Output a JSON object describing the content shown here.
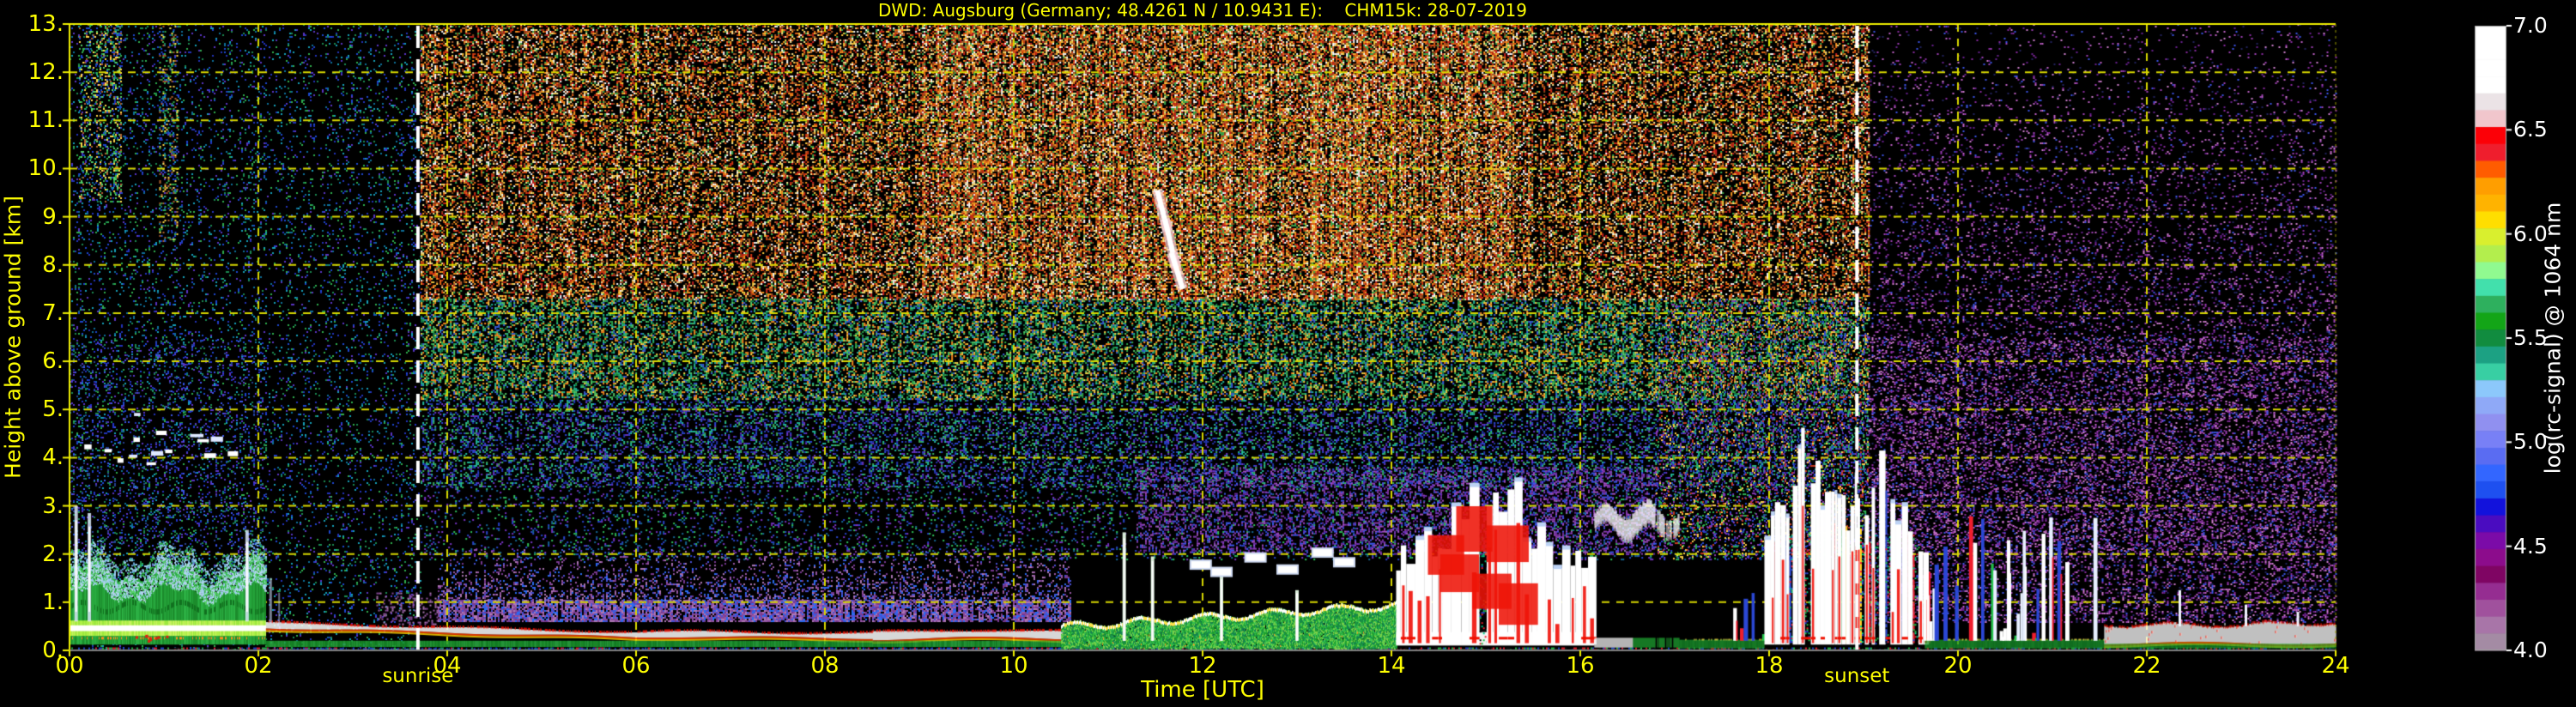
{
  "title": "DWD: Augsburg (Germany; 48.4261 N / 10.9431 E):    CHM15k: 28-07-2019",
  "colors": {
    "background": "#000000",
    "axis_text": "#fdfd02",
    "grid": "#d8d800",
    "border_left_top": "#f0f000",
    "border_bottom": "#808080",
    "sun_line": "#ffffff",
    "colorbar_text": "#ffffff"
  },
  "chart_data": {
    "type": "heatmap",
    "title": "DWD: Augsburg (Germany; 48.4261 N / 10.9431 E):    CHM15k: 28-07-2019",
    "xlabel": "Time [UTC]",
    "ylabel": "Height above ground [km]",
    "xlim": [
      0,
      24
    ],
    "ylim": [
      0,
      13
    ],
    "x_ticks": [
      "00",
      "02",
      "04",
      "06",
      "08",
      "10",
      "12",
      "14",
      "16",
      "18",
      "20",
      "22",
      "24"
    ],
    "x_tick_hours": [
      0,
      2,
      4,
      6,
      8,
      10,
      12,
      14,
      16,
      18,
      20,
      22,
      24
    ],
    "y_ticks": [
      "0.",
      "1.",
      "2.",
      "3.",
      "4.",
      "5.",
      "6.",
      "7.",
      "8.",
      "9.",
      "10.",
      "11.",
      "12.",
      "13."
    ],
    "y_tick_km": [
      0,
      1,
      2,
      3,
      4,
      5,
      6,
      7,
      8,
      9,
      10,
      11,
      12,
      13
    ],
    "grid": {
      "style": "dashed",
      "color": "#d8d800",
      "x_step_hours": 2,
      "y_step_km": 1
    },
    "annotations": [
      {
        "label": "sunrise",
        "time_utc": 3.69
      },
      {
        "label": "sunset",
        "time_utc": 18.93
      }
    ],
    "colorbar": {
      "label": "log(rc-signal) @ 1064 nm",
      "vmin": 4.0,
      "vmax": 7.0,
      "tick_labels": [
        "7.0",
        "6.5",
        "6.0",
        "5.5",
        "5.0",
        "4.5",
        "4.0"
      ],
      "tick_values": [
        7.0,
        6.5,
        6.0,
        5.5,
        5.0,
        4.5,
        4.0
      ],
      "colors_top_to_bottom": [
        "#ffffff",
        "#ffffff",
        "#ffffff",
        "#ffffff",
        "#ebe3e6",
        "#f1c6cc",
        "#fc0007",
        "#ef1e2d",
        "#ff5c00",
        "#ff9e00",
        "#ffb300",
        "#ffde00",
        "#d9ef2e",
        "#b3ee4d",
        "#90fa90",
        "#42e0ac",
        "#2eb05e",
        "#13a517",
        "#118c3f",
        "#1ca183",
        "#38cfa3",
        "#8cc8fb",
        "#8fa9f7",
        "#9090f0",
        "#7880f6",
        "#5a6cf2",
        "#3366ff",
        "#1e50f0",
        "#1212dc",
        "#4a0cc0",
        "#7b0ba8",
        "#8c0c8c",
        "#7f0563",
        "#952d91",
        "#a0519d",
        "#a875a8",
        "#a48ba4"
      ]
    },
    "noise_zones": [
      {
        "t": [
          0,
          3.72
        ],
        "h": [
          0,
          13
        ],
        "d": 0.11,
        "colors": [
          "#2233bb",
          "#2fae4e",
          "#1b8a50",
          "#1d47d0",
          "#5a35c4",
          "#0e6f9a",
          "#16a0b8"
        ]
      },
      {
        "t": [
          0,
          2.1
        ],
        "h": [
          2,
          6.5
        ],
        "d": 0.1,
        "colors": [
          "#2233cc",
          "#3c55e8",
          "#26418f",
          "#5a35c4",
          "#1b8a50"
        ]
      },
      {
        "t": [
          0.1,
          0.55
        ],
        "h": [
          9.3,
          13
        ],
        "d": 0.3,
        "colors": [
          "#2fae4e",
          "#57d06a",
          "#b06030",
          "#ffd84a",
          "#1d47d0"
        ]
      },
      {
        "t": [
          0.95,
          1.15
        ],
        "h": [
          8.5,
          13
        ],
        "d": 0.24,
        "colors": [
          "#2fae4e",
          "#b06030",
          "#1d47d0",
          "#ffd84a"
        ]
      },
      {
        "t": [
          3.72,
          19.05
        ],
        "h": [
          7.3,
          13
        ],
        "d": 0.66,
        "ramp": true,
        "colors": [
          "#d43a10",
          "#f06a18",
          "#ff9820",
          "#ffd040",
          "#ffffff",
          "#3fae4e",
          "#8a4618",
          "#000000",
          "#c81e1e",
          "#ffe990",
          "#b06030"
        ]
      },
      {
        "t": [
          3.72,
          19.05
        ],
        "h": [
          5.2,
          7.3
        ],
        "d": 0.55,
        "colors": [
          "#2fae4e",
          "#57d06a",
          "#15864f",
          "#ffd84a",
          "#3a62e0",
          "#23bfa0",
          "#000000",
          "#ff8c20"
        ]
      },
      {
        "t": [
          3.72,
          19.05
        ],
        "h": [
          3.4,
          5.2
        ],
        "d": 0.4,
        "colors": [
          "#2b47d4",
          "#3cae5c",
          "#6a35c8",
          "#23bfa0",
          "#000000",
          "#2233aa"
        ]
      },
      {
        "t": [
          3.72,
          19.05
        ],
        "h": [
          1.9,
          3.4
        ],
        "d": 0.18,
        "colors": [
          "#31c45c",
          "#2b47d4",
          "#7a35c8",
          "#186a9a",
          "#000000"
        ]
      },
      {
        "t": [
          11.3,
          16.8
        ],
        "h": [
          2.0,
          3.8
        ],
        "d": 0.3,
        "colors": [
          "#8a3ab0",
          "#6a2ba0",
          "#a050c0",
          "#3c55e8"
        ]
      },
      {
        "t": [
          3.25,
          3.9
        ],
        "h": [
          0.55,
          1.2
        ],
        "d": 0.22,
        "colors": [
          "#9a5aa8",
          "#8a4a9c",
          "#b07ab8"
        ]
      },
      {
        "t": [
          3.9,
          10.6
        ],
        "h": [
          0.6,
          1.05
        ],
        "d": 0.78,
        "colors": [
          "#9a5aa8",
          "#8a4a9c",
          "#7a3a94",
          "#4a52d8",
          "#2b6ef8",
          "#b07ab8"
        ]
      },
      {
        "t": [
          3.9,
          10.6
        ],
        "h": [
          1.05,
          2.1
        ],
        "d": 0.34,
        "fadeTop": true,
        "colors": [
          "#9a5aa8",
          "#7a3a94",
          "#4a52d8",
          "#2b6ef8",
          "#b07ab8"
        ]
      },
      {
        "t": [
          19.05,
          24
        ],
        "h": [
          0.6,
          13
        ],
        "d": 0.27,
        "fadeTop": true,
        "colors": [
          "#8a2ba0",
          "#a040b8",
          "#6a2090",
          "#3c55e8",
          "#c060c8",
          "#23225e",
          "#d080d0"
        ]
      },
      {
        "t": [
          19.05,
          24
        ],
        "h": [
          2.0,
          6.5
        ],
        "d": 0.12,
        "colors": [
          "#a040b8",
          "#8a2ba0",
          "#3c55e8",
          "#d080d0"
        ]
      },
      {
        "t": [
          16.8,
          19.05
        ],
        "h": [
          1.9,
          7.3
        ],
        "d": 0.28,
        "colors": [
          "#2fae4e",
          "#2b47d4",
          "#c83a20",
          "#8a3ab0",
          "#ffd04a",
          "#000000"
        ]
      },
      {
        "t": [
          0,
          24
        ],
        "h": [
          0,
          0.06
        ],
        "d": 0.5,
        "colors": [
          "#1d47d0",
          "#ef1e2d",
          "#22c24a",
          "#111111"
        ]
      }
    ],
    "features": [
      {
        "type": "night_mixed_layer",
        "t": [
          0,
          2.08
        ],
        "top_km": 1.65,
        "core": [
          0.3,
          0.62
        ]
      },
      {
        "type": "bl_columns",
        "items": [
          [
            0.07,
            3.0
          ],
          [
            0.21,
            2.85
          ],
          [
            1.88,
            2.5
          ]
        ]
      },
      {
        "type": "cloud_specks",
        "t": [
          0.1,
          1.95
        ],
        "h": [
          3.9,
          4.95
        ],
        "count": 15
      },
      {
        "type": "surface_line",
        "t": [
          2.08,
          10.6
        ],
        "h_start": 0.52,
        "h_end": 0.32
      },
      {
        "type": "day_bl",
        "t": [
          10.5,
          14.05
        ],
        "top_start": 0.52,
        "growth": 0.125,
        "spikes": [
          [
            11.17,
            2.45
          ],
          [
            11.47,
            1.95
          ],
          [
            12.2,
            1.55
          ],
          [
            13.0,
            1.25
          ]
        ]
      },
      {
        "type": "bl_clouds",
        "items": [
          [
            11.98,
            1.85
          ],
          [
            12.2,
            1.7
          ],
          [
            12.56,
            2.0
          ],
          [
            12.9,
            1.75
          ],
          [
            13.27,
            2.1
          ],
          [
            13.5,
            1.9
          ]
        ]
      },
      {
        "type": "cirrus",
        "segs": [
          [
            11.52,
            9.55,
            11.63,
            8.7
          ],
          [
            11.6,
            8.95,
            11.72,
            7.95
          ],
          [
            11.67,
            8.25,
            11.79,
            7.5
          ]
        ]
      },
      {
        "type": "towers",
        "t": [
          14.05,
          16.15
        ],
        "peak_t": 15.0,
        "hmax": 4.6,
        "base": true
      },
      {
        "type": "red_patches",
        "items": [
          [
            14.55,
            2.0
          ],
          [
            14.68,
            1.6
          ],
          [
            14.85,
            2.6
          ],
          [
            15.02,
            1.2
          ],
          [
            15.17,
            2.2
          ],
          [
            15.3,
            1.0
          ]
        ]
      },
      {
        "type": "stratus",
        "t": [
          16.15,
          17.05
        ],
        "h_center": 2.7
      },
      {
        "type": "sparse_columns",
        "t": [
          17.05,
          17.95
        ],
        "density": 0.18,
        "hmax": 1.2,
        "clusters": []
      },
      {
        "type": "towers",
        "t": [
          17.95,
          19.65
        ],
        "peak_t": 18.35,
        "peak2_t": 19.1,
        "hmax": 4.7,
        "thin": true
      },
      {
        "type": "sparse_columns",
        "t": [
          19.65,
          21.55
        ],
        "density": 0.45,
        "hmax": 2.6,
        "clusters": [
          20.15,
          21.0
        ]
      },
      {
        "type": "fog",
        "t": [
          21.55,
          24
        ],
        "top_km": 0.52,
        "columns": [
          [
            22.35,
            1.25
          ],
          [
            23.05,
            0.95
          ],
          [
            23.6,
            0.8
          ]
        ]
      }
    ]
  }
}
